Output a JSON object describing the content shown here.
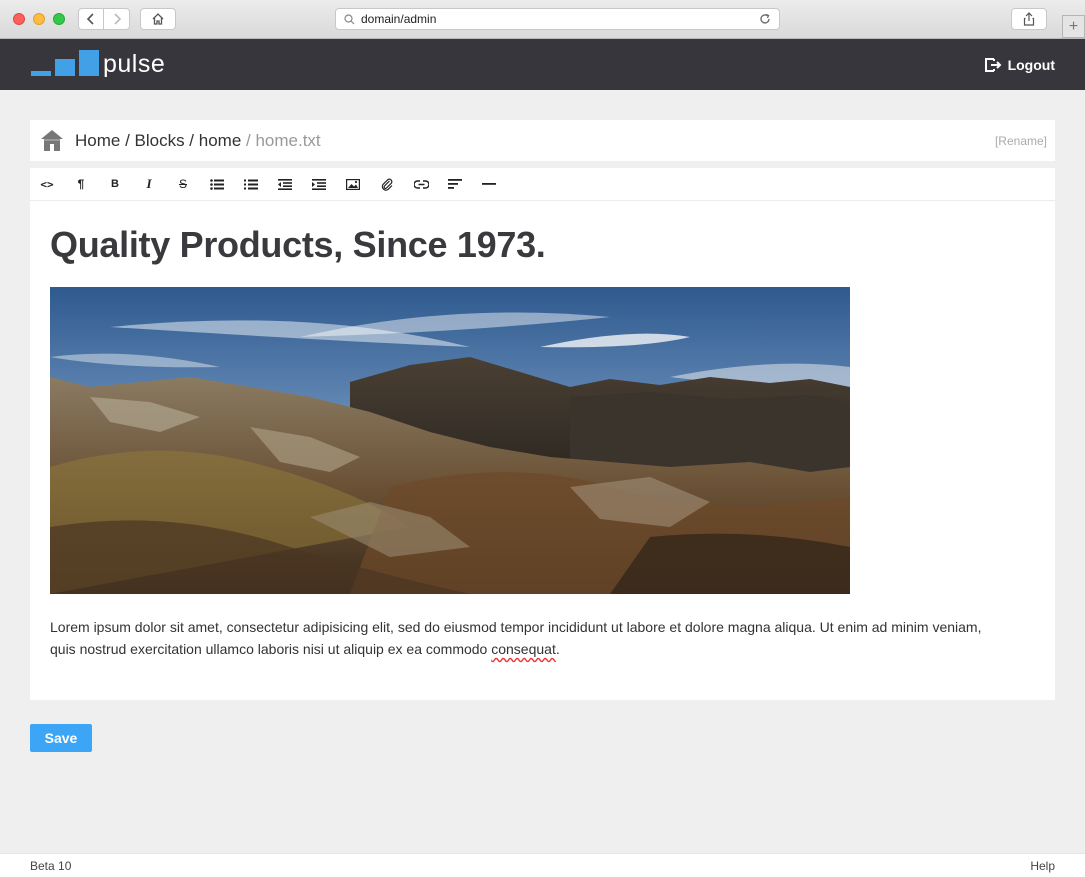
{
  "browser": {
    "url": "domain/admin",
    "new_tab_symbol": "+"
  },
  "app": {
    "brand": "pulse",
    "logout_label": "Logout",
    "brand_color": "#41a0e6",
    "header_bg": "#36363c"
  },
  "breadcrumb": {
    "path": "Home / Blocks / home",
    "current": " / home.txt",
    "rename_label": "[Rename]"
  },
  "toolbar": {
    "items": [
      {
        "name": "html-icon",
        "glyph": "<>"
      },
      {
        "name": "paragraph-icon",
        "glyph": "¶"
      },
      {
        "name": "bold-icon",
        "glyph": "B"
      },
      {
        "name": "italic-icon",
        "glyph": "I"
      },
      {
        "name": "strikethrough-icon",
        "glyph": "S"
      },
      {
        "name": "unordered-list-icon",
        "glyph": ""
      },
      {
        "name": "ordered-list-icon",
        "glyph": ""
      },
      {
        "name": "outdent-icon",
        "glyph": ""
      },
      {
        "name": "indent-icon",
        "glyph": ""
      },
      {
        "name": "image-icon",
        "glyph": ""
      },
      {
        "name": "file-link-icon",
        "glyph": ""
      },
      {
        "name": "link-icon",
        "glyph": ""
      },
      {
        "name": "align-icon",
        "glyph": ""
      },
      {
        "name": "horizontal-rule-icon",
        "glyph": ""
      }
    ]
  },
  "content": {
    "heading": "Quality Products, Since 1973.",
    "paragraph_main": "Lorem ipsum dolor sit amet, consectetur adipisicing elit, sed do eiusmod tempor incididunt ut labore et dolore magna aliqua. Ut enim ad minim veniam, quis nostrud exercitation ullamco laboris nisi ut aliquip ex ea commodo ",
    "paragraph_typo_word": "consequat",
    "paragraph_end": "."
  },
  "actions": {
    "save_label": "Save",
    "save_color": "#3da5f5"
  },
  "footer": {
    "version": "Beta 10",
    "help": "Help"
  }
}
